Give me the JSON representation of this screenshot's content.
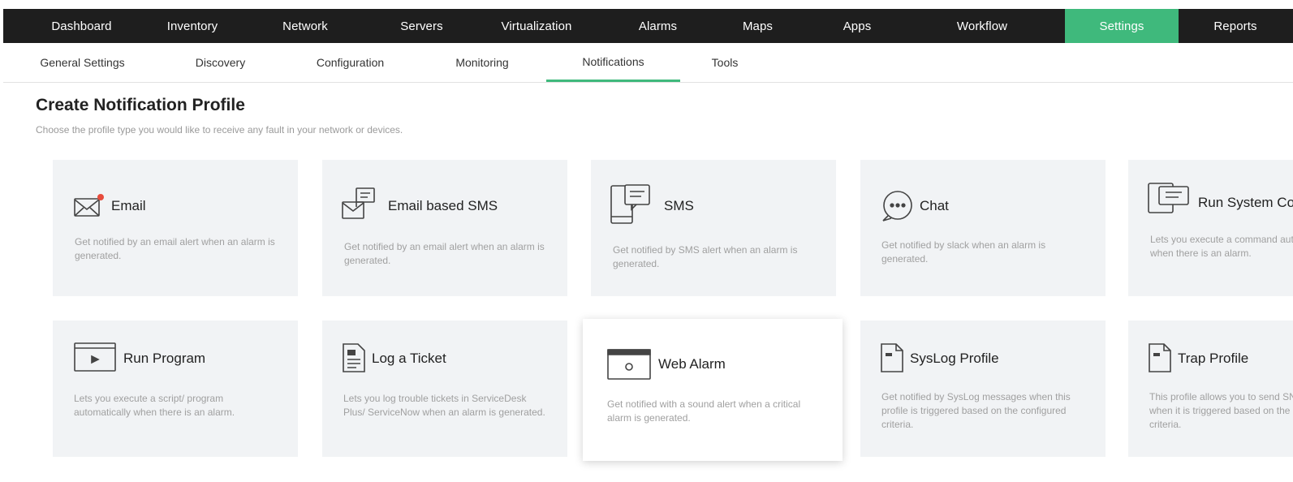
{
  "topnav": {
    "items": [
      "Dashboard",
      "Inventory",
      "Network",
      "Servers",
      "Virtualization",
      "Alarms",
      "Maps",
      "Apps",
      "Workflow",
      "Settings",
      "Reports"
    ],
    "active_index": 9
  },
  "subnav": {
    "items": [
      "General Settings",
      "Discovery",
      "Configuration",
      "Monitoring",
      "Notifications",
      "Tools"
    ],
    "active_index": 4
  },
  "page": {
    "title": "Create Notification Profile",
    "description": "Choose the profile type you would like to receive any fault in your network or devices."
  },
  "colors": {
    "accent": "#3fb97c",
    "nav_bg": "#1e1e1e",
    "card_bg": "#f1f3f5"
  },
  "cards": [
    {
      "title": "Email",
      "icon": "envelope-icon",
      "description": "Get notified by an email alert when an alarm is generated."
    },
    {
      "title": "Email based SMS",
      "icon": "email-sms-icon",
      "description": "Get notified by an email alert when an alarm is generated."
    },
    {
      "title": "SMS",
      "icon": "mobile-message-icon",
      "description": "Get notified by SMS alert when an alarm is generated."
    },
    {
      "title": "Chat",
      "icon": "chat-bubble-icon",
      "description": "Get notified by slack when an alarm is generated."
    },
    {
      "title": "Run System Command",
      "icon": "terminal-message-icon",
      "description": "Lets you execute a command automatically when there is an alarm."
    },
    {
      "title": "Run Program",
      "icon": "play-window-icon",
      "description": "Lets you execute a script/ program automatically when there is an alarm."
    },
    {
      "title": "Log a Ticket",
      "icon": "ticket-document-icon",
      "description": "Lets you log trouble tickets in ServiceDesk Plus/ ServiceNow when an alarm is generated."
    },
    {
      "title": "Web Alarm",
      "icon": "browser-alarm-icon",
      "description": "Get notified with a sound alert when a critical alarm is generated."
    },
    {
      "title": "SysLog Profile",
      "icon": "syslog-document-icon",
      "description": "Get notified by SysLog messages when this profile is triggered based on the configured criteria."
    },
    {
      "title": "Trap Profile",
      "icon": "trap-document-icon",
      "description": "This profile allows you to send SNMP traps when it is triggered based on the configured criteria."
    }
  ]
}
